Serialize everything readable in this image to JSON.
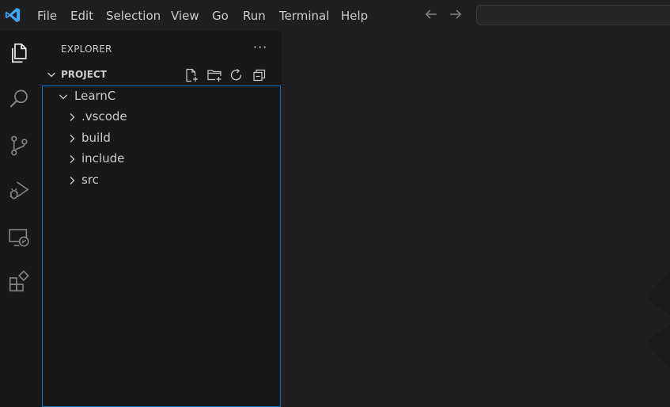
{
  "menu": {
    "items": [
      "File",
      "Edit",
      "Selection",
      "View",
      "Go",
      "Run",
      "Terminal",
      "Help"
    ]
  },
  "titlebar": {
    "logo_icon": "vscode-logo",
    "back_icon": "arrow-left-icon",
    "forward_icon": "arrow-right-icon"
  },
  "activity_bar": {
    "items": [
      "explorer-icon",
      "search-icon",
      "source-control-icon",
      "run-debug-icon",
      "remote-explorer-icon",
      "extensions-icon"
    ],
    "active": "explorer-icon"
  },
  "sidebar": {
    "title": "EXPLORER",
    "more": "···",
    "section": {
      "title": "PROJECT",
      "actions": [
        "new-file-icon",
        "new-folder-icon",
        "refresh-icon",
        "collapse-all-icon"
      ]
    },
    "tree": [
      {
        "label": "LearnC",
        "expanded": true
      },
      {
        "label": ".vscode",
        "expanded": false
      },
      {
        "label": "build",
        "expanded": false
      },
      {
        "label": "include",
        "expanded": false
      },
      {
        "label": "src",
        "expanded": false
      }
    ]
  },
  "colors": {
    "accent": "#0078d4",
    "logo": "#3ea7f5",
    "text": "#cccccc",
    "icon_inactive": "#858585"
  }
}
